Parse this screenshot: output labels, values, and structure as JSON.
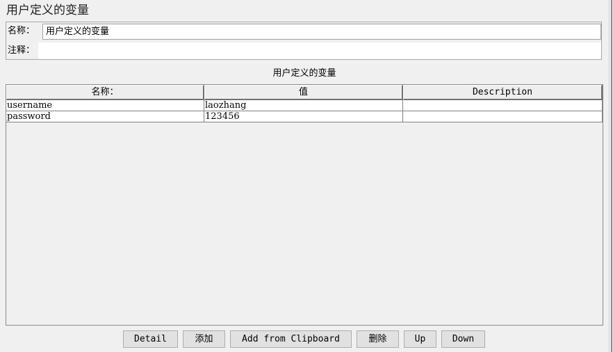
{
  "panel": {
    "title": "用户定义的变量",
    "name_label": "名称：",
    "name_value": "用户定义的变量",
    "comment_label": "注释：",
    "comment_value": ""
  },
  "table": {
    "caption": "用户定义的变量",
    "columns": [
      "名称：",
      "值",
      "Description"
    ],
    "rows": [
      [
        "username",
        "laozhang",
        ""
      ],
      [
        "password",
        "123456",
        ""
      ]
    ]
  },
  "buttons": {
    "detail": "Detail",
    "add": "添加",
    "add_from_clipboard": "Add from Clipboard",
    "delete": "删除",
    "up": "Up",
    "down": "Down"
  }
}
